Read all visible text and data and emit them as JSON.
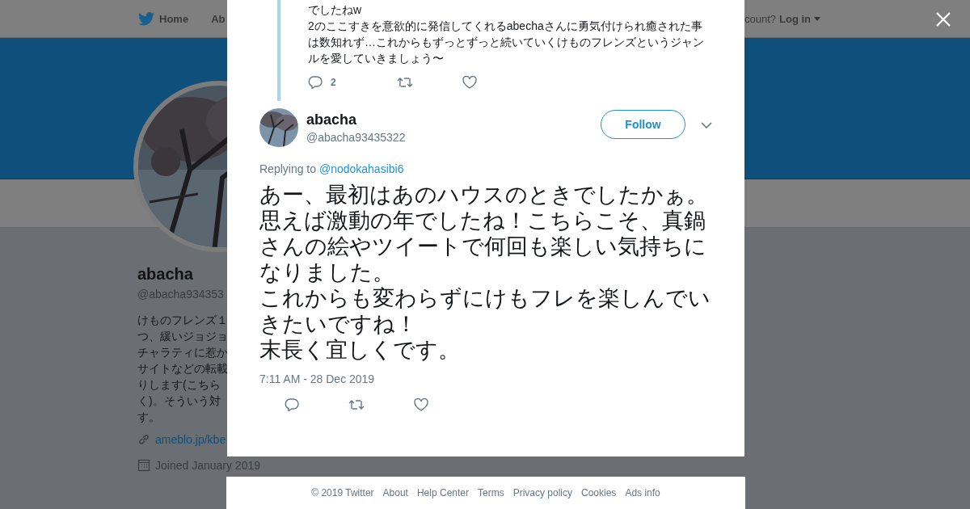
{
  "top_nav": {
    "items": [
      {
        "label": "Home"
      },
      {
        "label": "Ab"
      }
    ],
    "account_prompt": "count?",
    "login": "Log in"
  },
  "profile": {
    "name": "abacha",
    "handle": "@abacha934353",
    "bio_lines": [
      "けものフレンズ１",
      "つ、緩いジョジョ",
      "チャラティに惹か",
      "サイトなどの転載",
      "りします(こちら",
      "く)。そういう対",
      "す。"
    ],
    "link": "ameblo.jp/kbe",
    "joined": "Joined January 2019"
  },
  "quoted_tweet": {
    "text": "でしたねw\n2のここすきを意欲的に発信してくれるabechaさんに勇気付けられ癒された事は数知れず…これからもずっとずっと続いていくけものフレンズというジャンルを愛していきましょう〜",
    "reply_count": "2"
  },
  "tweet": {
    "name": "abacha",
    "handle": "@abacha93435322",
    "follow": "Follow",
    "replying_label": "Replying to",
    "replying_to": "@nodokahasibi6",
    "paragraphs": [
      "あー、最初はあのハウスのときでしたかぁ。",
      "思えば激動の年でしたね！こちらこそ、真鍋さんの絵やツイートで何回も楽しい気持ちになりました。",
      "これからも変わらずにけもフレを楽しんでいきたいですね！",
      "末長く宜しくです。"
    ],
    "time": "7:11 AM - 28 Dec 2019"
  },
  "footer": [
    "© 2019 Twitter",
    "About",
    "Help Center",
    "Terms",
    "Privacy policy",
    "Cookies",
    "Ads info"
  ]
}
